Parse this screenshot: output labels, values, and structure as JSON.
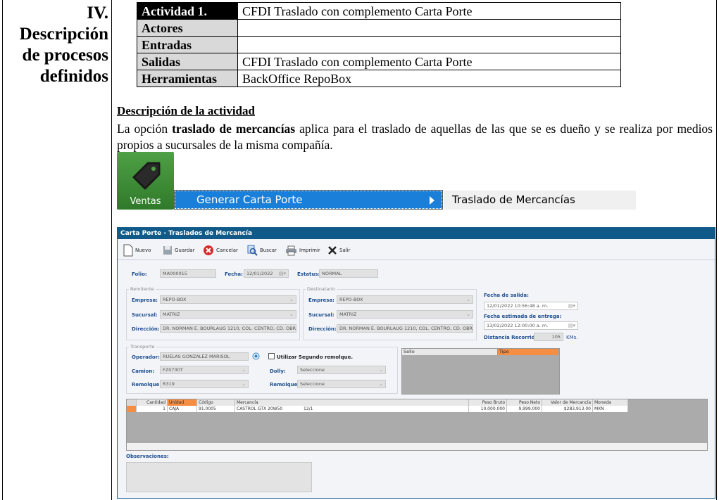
{
  "section": {
    "number": "IV.",
    "title_lines": [
      "Descripción",
      "de procesos",
      "definidos"
    ]
  },
  "activity_table": [
    {
      "key": "Actividad 1.",
      "value": "CFDI Traslado con complemento Carta Porte"
    },
    {
      "key": "Actores",
      "value": ""
    },
    {
      "key": "Entradas",
      "value": ""
    },
    {
      "key": "Salidas",
      "value": "CFDI Traslado con complemento Carta Porte"
    },
    {
      "key": "Herramientas",
      "value": "BackOffice RepoBox"
    }
  ],
  "description": {
    "title": "Descripción de la actividad",
    "text_before": "La opción ",
    "text_bold": "traslado de mercancías",
    "text_after": " aplica para el traslado de aquellas de las que se es dueño y se realiza por medios propios a sucursales de la misma compañía."
  },
  "menu": {
    "module": "Ventas",
    "item": "Generar Carta Porte",
    "subitem": "Traslado de Mercancías"
  },
  "app": {
    "title": "Carta Porte - Traslados de Mercancía",
    "toolbar": {
      "nuevo": "Nuevo",
      "guardar": "Guardar",
      "cancelar": "Cancelar",
      "buscar": "Buscar",
      "imprimir": "Imprimir",
      "salir": "Salir"
    },
    "folio_label": "Folio:",
    "folio": "MA000015",
    "fecha_label": "Fecha:",
    "fecha": "12/01/2022",
    "estatus_label": "Estatus:",
    "estatus": "NORMAL",
    "remitente": {
      "title": "Remitente",
      "empresa_label": "Empresa:",
      "empresa": "REPO-BOX",
      "sucursal_label": "Sucursal:",
      "sucursal": "MATRIZ",
      "direccion_label": "Dirección:",
      "direccion": "DR. NORMAN E. BOURLAUG 1210, COL. CENTRO, CD. OBR"
    },
    "destinatario": {
      "title": "Destinatario",
      "empresa_label": "Empresa:",
      "empresa": "REPO-BOX",
      "sucursal_label": "Sucursal:",
      "sucursal": "MATRIZ",
      "direccion_label": "Dirección:",
      "direccion": "DR. NORMAN E. BOURLAUG 1210, COL. CENTRO, CD. OBR"
    },
    "fechas": {
      "salida_label": "Fecha de salida:",
      "salida": "12/01/2022 10:56:48 a. m.",
      "entrega_label": "Fecha estimada de entrega:",
      "entrega": "13/02/2022 12:00:00 a. m.",
      "distancia_label": "Distancia Recorrida:",
      "distancia": "105",
      "distancia_unit": "KMs."
    },
    "transporte": {
      "title": "Transporte",
      "operador_label": "Operador:",
      "operador": "RUELAS GONZALEZ MARISOL",
      "segundo_remolque": "Utilizar Segundo remolque.",
      "camion_label": "Camion:",
      "camion": "FZ0730T",
      "dolly_label": "Dolly:",
      "dolly": "Seleccione",
      "remolque_label": "Remolque:",
      "remolque": "R319",
      "remolque2_label": "Remolque:",
      "remolque2": "Seleccione"
    },
    "sello_grid": {
      "col_sello": "Sello",
      "col_tipo": "Tipo"
    },
    "items": {
      "headers": [
        "Cantidad",
        "Unidad",
        "Código",
        "Mercancía",
        "Peso Bruto",
        "Peso Neto",
        "Valor de Mercancía",
        "Moneda"
      ],
      "rows": [
        {
          "cantidad": "1",
          "unidad": "CAJA",
          "codigo": "91.0005",
          "mercancia": "CASTROL GTX 20W50",
          "extra": "12/1",
          "peso_bruto": "10,000.000",
          "peso_neto": "9,999.000",
          "valor": "$283,913.00",
          "moneda": "MXN"
        }
      ]
    },
    "observaciones_label": "Observaciones:"
  },
  "colors": {
    "title_bar": "#0f5a89",
    "menu_highlight": "#1a7fd8",
    "ventas_green": "#3d8f37",
    "label_blue": "#1e4f8f"
  }
}
